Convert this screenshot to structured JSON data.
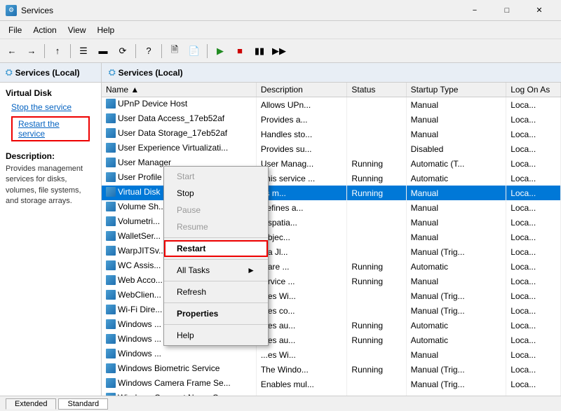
{
  "window": {
    "title": "Services",
    "icon": "⚙"
  },
  "menu": {
    "items": [
      "File",
      "Action",
      "View",
      "Help"
    ]
  },
  "toolbar": {
    "buttons": [
      "←",
      "→",
      "⬆",
      "📋",
      "📋",
      "🔄",
      "❓",
      "📋",
      "📋",
      "▶",
      "■",
      "⏸",
      "⏭"
    ]
  },
  "left_panel": {
    "header": "Services (Local)",
    "service_title": "Virtual Disk",
    "link_stop": "Stop the service",
    "link_restart": "Restart the service",
    "description_title": "Description:",
    "description": "Provides management services for disks, volumes, file systems, and storage arrays."
  },
  "right_panel": {
    "header": "Services (Local)",
    "columns": [
      "Name",
      "Description",
      "Status",
      "Startup Type",
      "Log On As"
    ],
    "services": [
      {
        "name": "UPnP Device Host",
        "desc": "Allows UPn...",
        "status": "",
        "startup": "Manual",
        "log": "Loca..."
      },
      {
        "name": "User Data Access_17eb52af",
        "desc": "Provides a...",
        "status": "",
        "startup": "Manual",
        "log": "Loca..."
      },
      {
        "name": "User Data Storage_17eb52af",
        "desc": "Handles sto...",
        "status": "",
        "startup": "Manual",
        "log": "Loca..."
      },
      {
        "name": "User Experience Virtualizati...",
        "desc": "Provides su...",
        "status": "",
        "startup": "Disabled",
        "log": "Loca..."
      },
      {
        "name": "User Manager",
        "desc": "User Manag...",
        "status": "Running",
        "startup": "Automatic (T...",
        "log": "Loca..."
      },
      {
        "name": "User Profile Service",
        "desc": "This service ...",
        "status": "Running",
        "startup": "Automatic",
        "log": "Loca..."
      },
      {
        "name": "Virtual Disk",
        "desc": "es m...",
        "status": "Running",
        "startup": "Manual",
        "log": "Loca...",
        "selected": true
      },
      {
        "name": "Volume Sh...",
        "desc": "Defines a...",
        "status": "",
        "startup": "Manual",
        "log": "Loca..."
      },
      {
        "name": "Volumetri...",
        "desc": "...spatia...",
        "status": "",
        "startup": "Manual",
        "log": "Loca..."
      },
      {
        "name": "WalletSer...",
        "desc": "...bjec...",
        "status": "",
        "startup": "Manual",
        "log": "Loca..."
      },
      {
        "name": "WarpJITSv...",
        "desc": "...a Jl...",
        "status": "",
        "startup": "Manual (Trig...",
        "log": "Loca..."
      },
      {
        "name": "WC Assis...",
        "desc": "...are ...",
        "status": "Running",
        "startup": "Automatic",
        "log": "Loca..."
      },
      {
        "name": "Web Acco...",
        "desc": "...rvice ...",
        "status": "Running",
        "startup": "Manual",
        "log": "Loca..."
      },
      {
        "name": "WebClien...",
        "desc": "...es Wi...",
        "status": "",
        "startup": "Manual (Trig...",
        "log": "Loca..."
      },
      {
        "name": "Wi-Fi Dire...",
        "desc": "...es co...",
        "status": "",
        "startup": "Manual (Trig...",
        "log": "Loca..."
      },
      {
        "name": "Windows ...",
        "desc": "...es au...",
        "status": "Running",
        "startup": "Automatic",
        "log": "Loca..."
      },
      {
        "name": "Windows ...",
        "desc": "...es au...",
        "status": "Running",
        "startup": "Automatic",
        "log": "Loca..."
      },
      {
        "name": "Windows ...",
        "desc": "...es Wi...",
        "status": "",
        "startup": "Manual",
        "log": "Loca..."
      },
      {
        "name": "Windows Biometric Service",
        "desc": "The Windo...",
        "status": "Running",
        "startup": "Manual (Trig...",
        "log": "Loca..."
      },
      {
        "name": "Windows Camera Frame Se...",
        "desc": "Enables mul...",
        "status": "",
        "startup": "Manual (Trig...",
        "log": "Loca..."
      },
      {
        "name": "Windows Connect Now - C...",
        "desc": "WCNCSVC ...",
        "status": "",
        "startup": "Manual",
        "log": "Loca..."
      }
    ]
  },
  "context_menu": {
    "items": [
      {
        "label": "Start",
        "disabled": true
      },
      {
        "label": "Stop",
        "disabled": false
      },
      {
        "label": "Pause",
        "disabled": true
      },
      {
        "label": "Resume",
        "disabled": true
      },
      {
        "label": "Restart",
        "disabled": false,
        "highlighted": true
      },
      {
        "label": "All Tasks",
        "disabled": false,
        "hasArrow": true
      },
      {
        "label": "Refresh",
        "disabled": false
      },
      {
        "label": "Properties",
        "disabled": false,
        "bold": true
      },
      {
        "label": "Help",
        "disabled": false
      }
    ]
  },
  "status_bar": {
    "tabs": [
      "Extended",
      "Standard"
    ]
  },
  "colors": {
    "selected_bg": "#0078d7",
    "selected_text": "#ffffff",
    "highlight_border": "#cc0000",
    "link_color": "#0563C1"
  }
}
